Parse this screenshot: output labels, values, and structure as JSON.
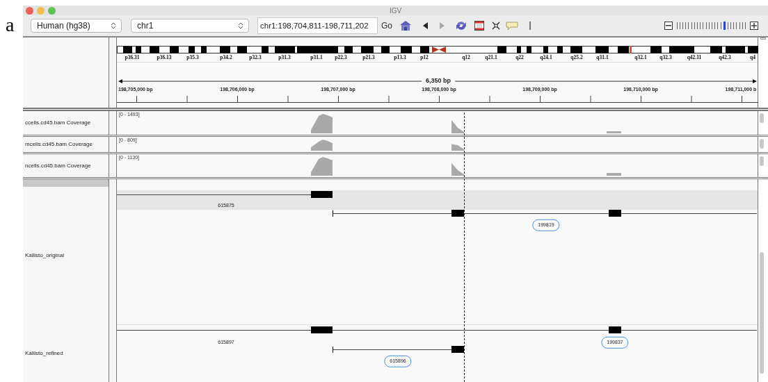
{
  "figure_label": "a",
  "window": {
    "title": "IGV"
  },
  "toolbar": {
    "genome": "Human (hg38)",
    "chromosome": "chr1",
    "locus": "chr1:198,704,811-198,711,202",
    "go": "Go",
    "nav": [
      {
        "kind": "back",
        "disabled": false
      },
      {
        "kind": "forward",
        "disabled": true
      }
    ],
    "zoom": {
      "level": 0.7
    }
  },
  "ideogram": {
    "bands": [
      "p36.31",
      "p36.13",
      "p35.3",
      "p34.2",
      "p32.3",
      "p31.3",
      "p31.1",
      "p22.3",
      "p21.3",
      "p13.3",
      "p12",
      "q12",
      "q21.1",
      "q22",
      "q24.1",
      "q25.2",
      "q31.1",
      "q32.1",
      "q32.3",
      "q42.11",
      "q42.3",
      "q4"
    ]
  },
  "ruler": {
    "span": "6,350 bp",
    "positions": [
      "198,705,000 bp",
      "198,706,000 bp",
      "198,707,000 bp",
      "198,708,000 bp",
      "198,709,000 bp",
      "198,710,000 bp",
      "198,711,000 b"
    ]
  },
  "coverage_tracks": [
    {
      "name": "ccells.cd45.bam Coverage",
      "range": "[0 - 1493]"
    },
    {
      "name": "mcells.cd45.bam Coverage",
      "range": "[0 - 809]"
    },
    {
      "name": "ncells.cd45.bam Coverage",
      "range": "[0 - 1130]"
    }
  ],
  "feature_tracks": [
    {
      "name": "Kallisto_original",
      "features": [
        {
          "label": "615875",
          "kind": "plain"
        },
        {
          "label": "199819",
          "kind": "boxed"
        }
      ]
    },
    {
      "name": "Kallisto_refined",
      "features": [
        {
          "label": "615897",
          "kind": "plain"
        },
        {
          "label": "199837",
          "kind": "boxed"
        },
        {
          "label": "615896",
          "kind": "boxed"
        }
      ]
    }
  ]
}
